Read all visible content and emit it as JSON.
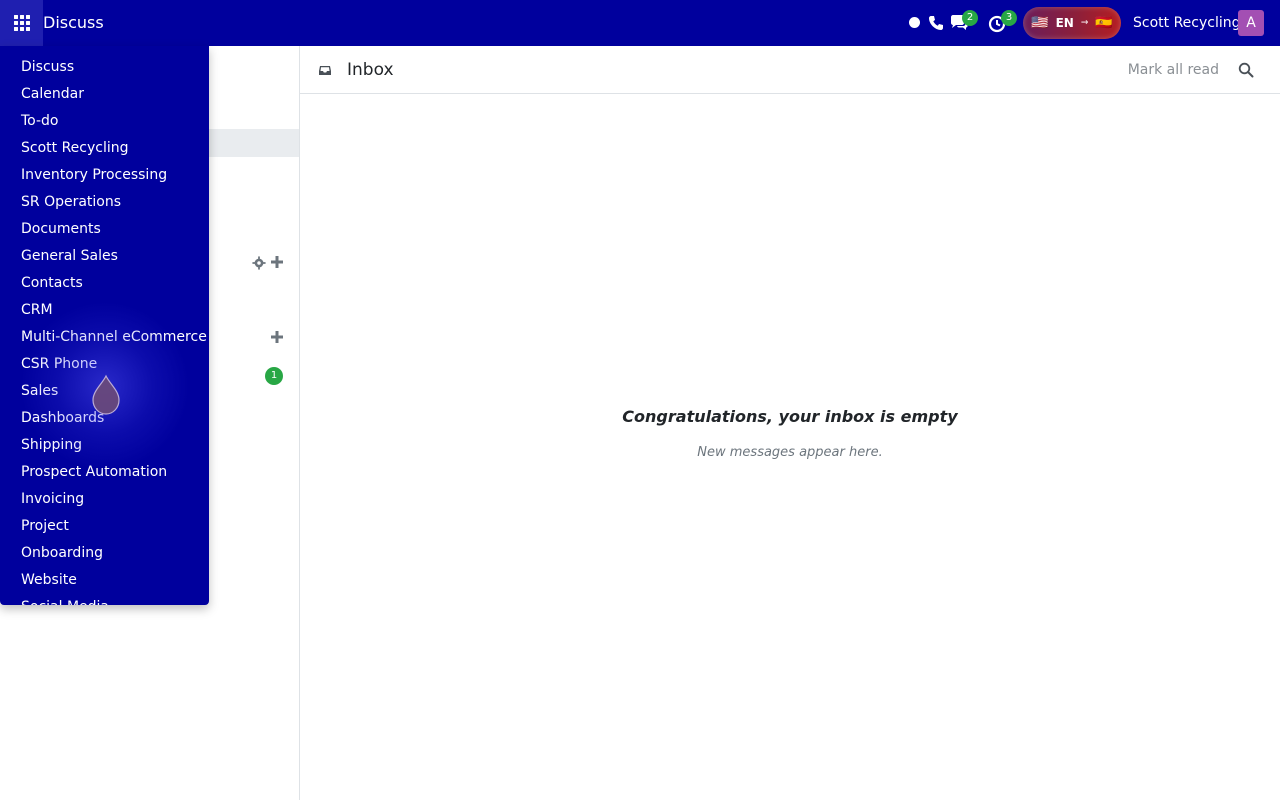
{
  "navbar": {
    "app_name": "Discuss",
    "messages_count": "2",
    "activities_count": "3",
    "language": "EN",
    "language_from_flag": "🇺🇸",
    "language_to_flag": "🇪🇸",
    "company": "Scott Recycling",
    "avatar_letter": "A",
    "colors": {
      "navbar_bg": "#00009d",
      "avatar_bg": "#a34fb3",
      "badge_green": "#28a745"
    }
  },
  "apps_menu": {
    "items": [
      "Discuss",
      "Calendar",
      "To-do",
      "Scott Recycling",
      "Inventory Processing",
      "SR Operations",
      "Documents",
      "General Sales",
      "Contacts",
      "CRM",
      "Multi-Channel eCommerce",
      "CSR Phone",
      "Sales",
      "Dashboards",
      "Shipping",
      "Prospect Automation",
      "Invoicing",
      "Project",
      "Onboarding",
      "Website",
      "Social Media"
    ]
  },
  "sidebar": {
    "chat_badge": "1"
  },
  "main": {
    "title": "Inbox",
    "mark_all_read": "Mark all read",
    "empty_title": "Congratulations, your inbox is empty",
    "empty_subtitle": "New messages appear here."
  }
}
